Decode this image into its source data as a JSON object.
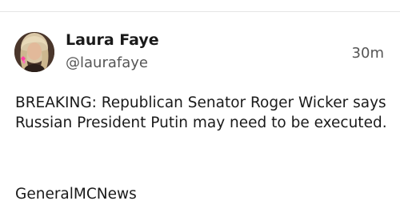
{
  "post": {
    "author": {
      "display_name": "Laura Faye",
      "handle": "@laurafaye"
    },
    "timestamp": "30m",
    "text": "BREAKING: Republican Senator Roger Wicker says Russian President Putin may need to be executed.",
    "source": "GeneralMCNews"
  },
  "colors": {
    "text_primary": "#1a1a1a",
    "text_secondary": "#555555",
    "divider": "#e6e6e6",
    "background": "#ffffff"
  }
}
